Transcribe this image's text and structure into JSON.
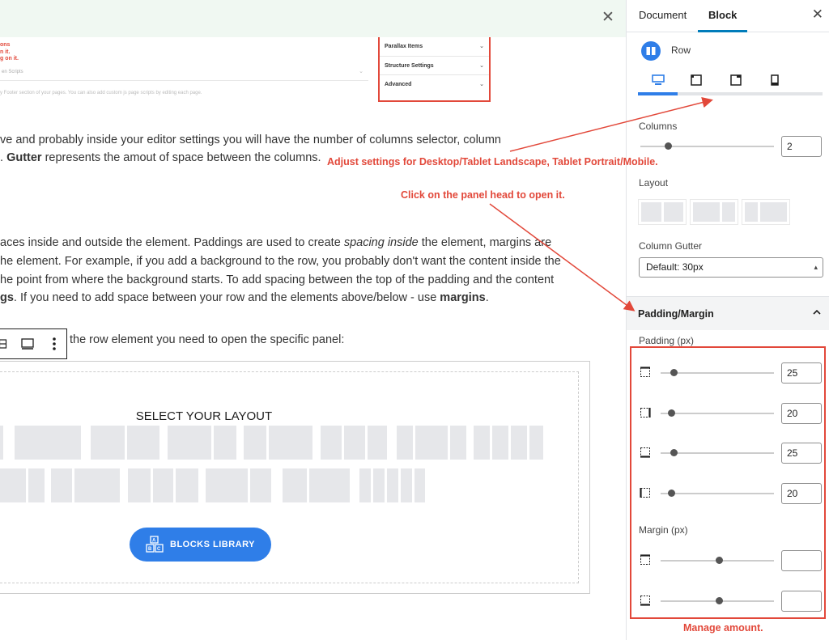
{
  "editor": {
    "screenshot": {
      "red_lines": [
        "ons",
        "n it.",
        "g on it."
      ],
      "row_text": "en Scripts",
      "muted_text": "y Footer section of your pages. You can also add custom js page scripts by editing each page.",
      "panel_items": [
        "Parallax Items",
        "Structure Settings",
        "Advanced"
      ]
    },
    "para1": {
      "line1": "ve and probably inside your editor settings you will have the number of columns selector, column",
      "line2_pre": ". ",
      "line2_bold": "Gutter",
      "line2_post": " represents the amout of space between the columns."
    },
    "para2": {
      "line1_pre": "aces inside and outside the element. Paddings are used to create ",
      "line1_em": "spacing inside",
      "line1_post": " the element, margins are",
      "line2": "he element. For example, if you add a background to the row, you probably don't want the content inside the",
      "line3": "he point from where the background starts. To add spacing between the top of the padding and the content",
      "line4_bold1": "gs",
      "line4_mid": ". If you need to add space between your row and the elements above/below - use ",
      "line4_bold2": "margins",
      "line4_end": "."
    },
    "para3": "the row element you need to open the specific panel:",
    "layout_title": "SELECT YOUR LAYOUT",
    "blocks_library": "BLOCKS LIBRARY"
  },
  "sidebar": {
    "tabs": [
      "Document",
      "Block"
    ],
    "active_tab": "Block",
    "block_name": "Row",
    "devices": [
      "desktop-icon",
      "tablet-landscape-icon",
      "tablet-portrait-icon",
      "mobile-icon"
    ],
    "columns_label": "Columns",
    "columns_value": "2",
    "layout_label": "Layout",
    "gutter_label": "Column Gutter",
    "gutter_value": "Default: 30px",
    "panel_title": "Padding/Margin",
    "padding_label": "Padding (px)",
    "padding": [
      {
        "side": "top",
        "value": "25",
        "level": 0.1
      },
      {
        "side": "right",
        "value": "20",
        "level": 0.08
      },
      {
        "side": "bottom",
        "value": "25",
        "level": 0.1
      },
      {
        "side": "left",
        "value": "20",
        "level": 0.08
      }
    ],
    "margin_label": "Margin (px)",
    "margin": [
      {
        "side": "top",
        "value": "",
        "level": 0.5
      },
      {
        "side": "bottom",
        "value": "",
        "level": 0.5
      }
    ]
  },
  "annotations": {
    "adjust": "Adjust settings for Desktop/Tablet Landscape, Tablet Portrait/Mobile.",
    "click": "Click on the panel head to open it.",
    "manage": "Manage amount."
  },
  "colors": {
    "annotation_red": "#e2483a",
    "accent_blue": "#2f7ee8",
    "notice_green": "#f0f8f2"
  }
}
